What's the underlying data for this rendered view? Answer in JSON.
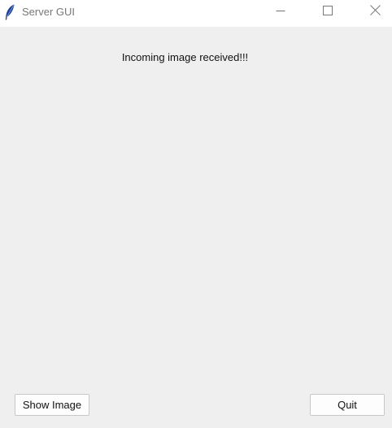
{
  "window": {
    "title": "Server GUI",
    "icons": {
      "app": "feather-icon",
      "minimize": "minimize-icon",
      "maximize": "maximize-icon",
      "close": "close-icon"
    }
  },
  "main": {
    "status_text": "Incoming image received!!!"
  },
  "buttons": {
    "show_image": "Show Image",
    "quit": "Quit"
  }
}
